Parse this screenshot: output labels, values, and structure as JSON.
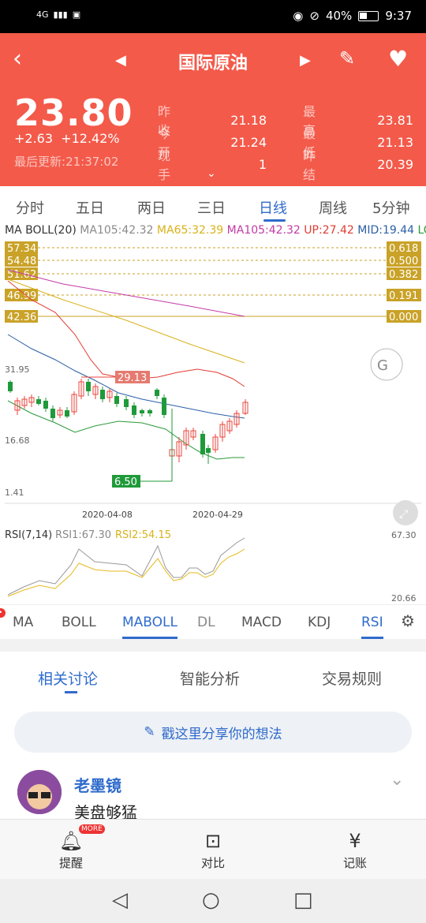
{
  "status_bar": {
    "network": "4G",
    "battery": "40%",
    "time": "9:37"
  },
  "header": {
    "title": "国际原油",
    "price": "23.80",
    "change": "+2.63",
    "change_pct": "+12.42%",
    "updated_label": "最后更新:",
    "updated_time": "21:37:02",
    "quotes": [
      {
        "label": "昨收",
        "value": "21.18",
        "label2": "最高",
        "value2": "23.81"
      },
      {
        "label": "今开",
        "value": "21.24",
        "label2": "最低",
        "value2": "21.13"
      },
      {
        "label": "现手",
        "value": "1",
        "label2": "昨结",
        "value2": "20.39"
      }
    ]
  },
  "period_tabs": [
    "分时",
    "五日",
    "两日",
    "三日",
    "日线",
    "周线",
    "5分钟"
  ],
  "active_period": "日线",
  "legend": {
    "name": "MA BOLL(20)",
    "ma105": "MA105:42.32",
    "ma65": "MA65:32.39",
    "ma105b": "MA105:42.32",
    "up": "UP:27.42",
    "mid": "MID:19.44",
    "low": "LOW:"
  },
  "fib_levels": [
    {
      "price": "57.34",
      "ratio": "0.618"
    },
    {
      "price": "54.48",
      "ratio": "0.500"
    },
    {
      "price": "51.62",
      "ratio": "0.382"
    },
    {
      "price": "46.99",
      "ratio": "0.191"
    },
    {
      "price": "42.36",
      "ratio": "0.000"
    }
  ],
  "chart_labels": {
    "y_top": "31.95",
    "y_mid": "16.68",
    "y_bottom": "1.41",
    "high_marker": "29.13",
    "low_marker": "6.50",
    "date1": "2020-04-08",
    "date2": "2020-04-29",
    "rsi_title": "RSI(7,14)",
    "rsi1": "RSI1:67.30",
    "rsi2": "RSI2:54.15",
    "rsi_top": "67.30",
    "rsi_bottom": "20.66"
  },
  "indicator_tabs": [
    "MA",
    "BOLL",
    "MABOLL",
    "DL",
    "MACD",
    "KDJ",
    "RSI"
  ],
  "active_indicators": [
    "MABOLL",
    "RSI"
  ],
  "discussion": {
    "tabs": [
      "相关讨论",
      "智能分析",
      "交易规则"
    ],
    "share_placeholder": "戳这里分享你的想法",
    "username": "老墨镜",
    "post": "美盘够猛"
  },
  "toolbar": {
    "items": [
      {
        "label": "提醒",
        "badge": "MORE"
      },
      {
        "label": "对比"
      },
      {
        "label": "记账"
      }
    ]
  },
  "colors": {
    "header_bg": "#f35a4a",
    "accent": "#2f6bcc",
    "up": "#e8463c",
    "down": "#1f9a3a"
  }
}
